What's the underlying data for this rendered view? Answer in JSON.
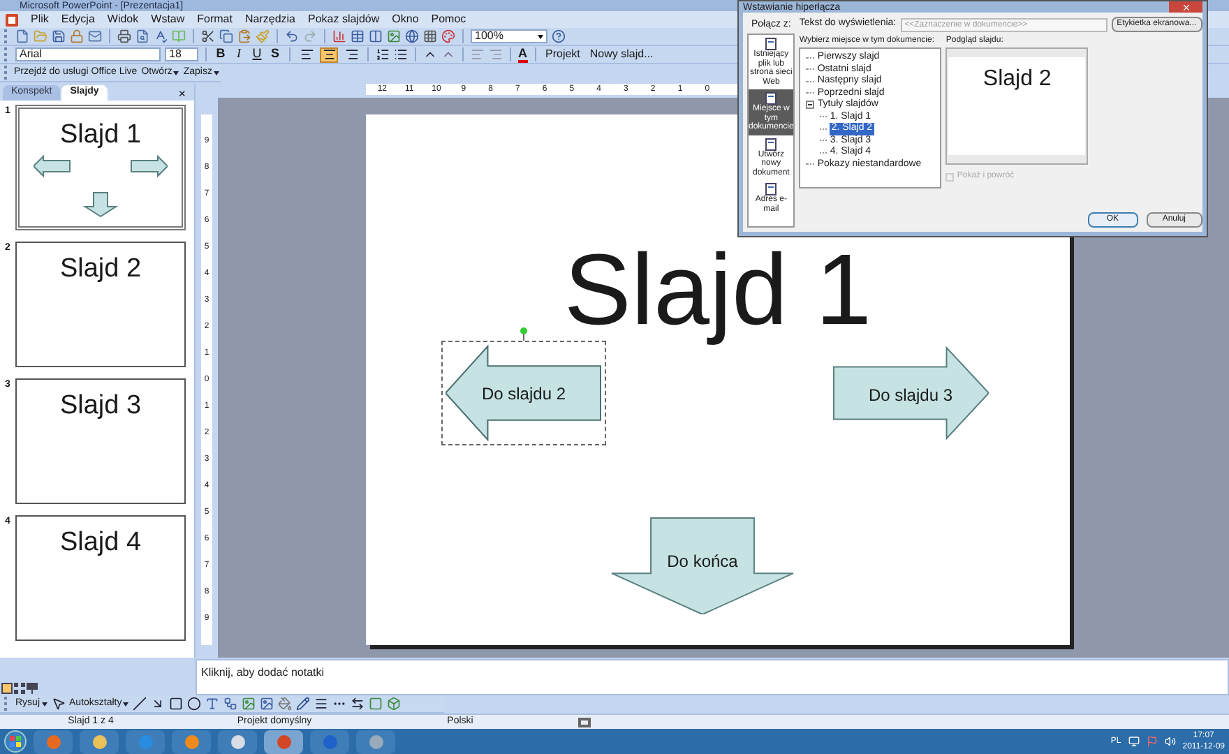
{
  "window": {
    "title": "Microsoft PowerPoint - [Prezentacja1]"
  },
  "menu": [
    "Plik",
    "Edycja",
    "Widok",
    "Wstaw",
    "Format",
    "Narzędzia",
    "Pokaz slajdów",
    "Okno",
    "Pomoc"
  ],
  "standard_toolbar": {
    "zoom": "100%"
  },
  "formatting_toolbar": {
    "font": "Arial",
    "size": "18",
    "bold": "B",
    "italic": "I",
    "underline": "U",
    "shadow": "S",
    "font_color": "A",
    "design": "Projekt",
    "new_slide": "Nowy slajd...",
    "alignment": [
      {
        "selected": false
      },
      {
        "selected": true
      },
      {
        "selected": false
      }
    ]
  },
  "online_toolbar": {
    "go": "Przejdź do usługi Office Live",
    "open": "Otwórz",
    "save": "Zapisz"
  },
  "panel": {
    "tabs": [
      {
        "label": "Konspekt",
        "selected": false
      },
      {
        "label": "Slajdy",
        "selected": true
      }
    ],
    "close": "×",
    "slides": [
      {
        "number": "1",
        "title": "Slajd 1",
        "kind": "buttons",
        "selected": true
      },
      {
        "number": "2",
        "title": "Slajd 2",
        "kind": "title",
        "selected": false
      },
      {
        "number": "3",
        "title": "Slajd 3",
        "kind": "title",
        "selected": false
      },
      {
        "number": "4",
        "title": "Slajd 4",
        "kind": "title",
        "selected": false
      }
    ]
  },
  "ruler": {
    "horizontal": [
      "12",
      "11",
      "10",
      "9",
      "8",
      "7",
      "6",
      "5",
      "4",
      "3",
      "2",
      "1",
      "0"
    ],
    "vertical": [
      "9",
      "8",
      "7",
      "6",
      "5",
      "4",
      "3",
      "2",
      "1",
      "0",
      "1",
      "2",
      "3",
      "4",
      "5",
      "6",
      "7",
      "8",
      "9"
    ]
  },
  "slide": {
    "title": "Slajd 1",
    "buttons": [
      {
        "kind": "left",
        "label": "Do slajdu 2",
        "selected": true
      },
      {
        "kind": "right",
        "label": "Do slajdu 3",
        "selected": false
      },
      {
        "kind": "down",
        "label": "Do końca",
        "selected": false
      }
    ]
  },
  "notes": {
    "placeholder": "Kliknij, aby dodać notatki"
  },
  "drawing_toolbar": {
    "draw": "Rysuj",
    "autoshapes": "Autokształty"
  },
  "status_bar": [
    "Slajd 1 z 4",
    "Projekt domyślny",
    "Polski"
  ],
  "taskbar": {
    "language": "PL",
    "time": "17:07",
    "date": "2011-12-09"
  },
  "dialog": {
    "title": "Wstawianie hiperłącza",
    "link_to_label": "Połącz z:",
    "places": [
      {
        "label": "Istniejący plik lub strona sieci Web",
        "selected": false
      },
      {
        "label": "Miejsce w tym dokumencie",
        "selected": true
      },
      {
        "label": "Utwórz nowy dokument",
        "selected": false
      },
      {
        "label": "Adres e-mail",
        "selected": false
      }
    ],
    "text_label": "Tekst do wyświetlenia:",
    "text_value": "<<Zaznaczenie w dokumencie>>",
    "screentip": "Etykietka ekranowa...",
    "tree_label": "Wybierz miejsce w tym dokumencie:",
    "tree": [
      {
        "label": "Pierwszy slajd",
        "selected": false
      },
      {
        "label": "Ostatni slajd",
        "selected": false
      },
      {
        "label": "Następny slajd",
        "selected": false
      },
      {
        "label": "Poprzedni slajd",
        "selected": false
      },
      {
        "label": "Tytuły slajdów",
        "selected": false,
        "expanded": true,
        "children": [
          {
            "label": "1. Slajd 1",
            "selected": false
          },
          {
            "label": "2. Slajd 2",
            "selected": true
          },
          {
            "label": "3. Slajd 3",
            "selected": false
          },
          {
            "label": "4. Slajd 4",
            "selected": false
          }
        ]
      },
      {
        "label": "Pokazy niestandardowe",
        "selected": false
      }
    ],
    "preview_label": "Podgląd slajdu:",
    "preview_title": "Slajd 2",
    "show_return": {
      "label": "Pokaż i powróć",
      "checked": false,
      "disabled": true
    },
    "ok": "OK",
    "cancel": "Anuluj"
  }
}
